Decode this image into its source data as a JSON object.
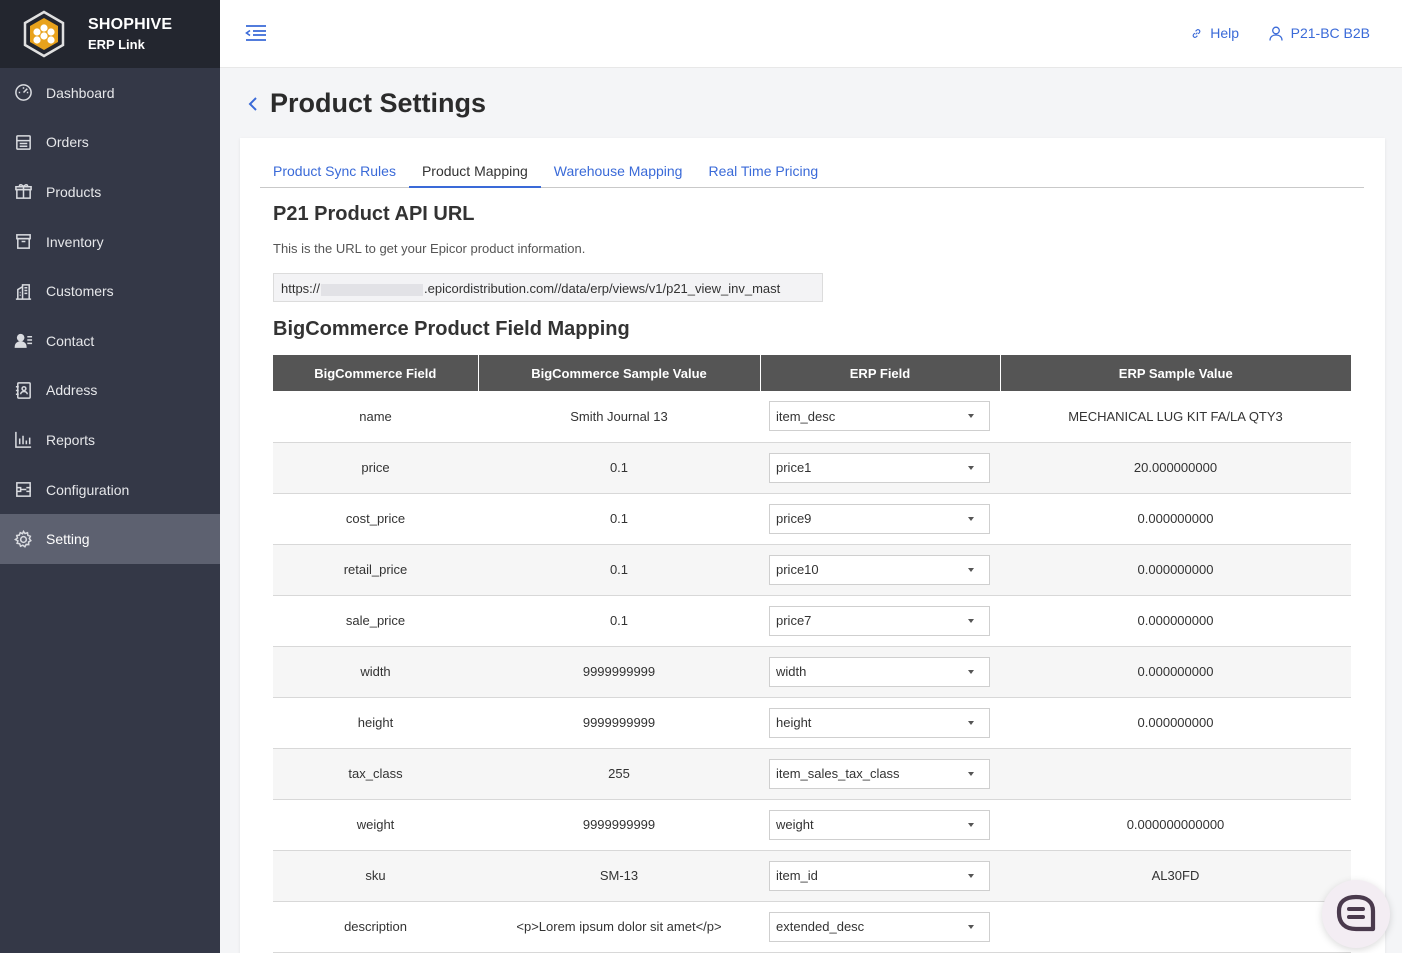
{
  "brand": {
    "name": "SHOPHIVE",
    "sub": "ERP Link"
  },
  "sidebar": {
    "items": [
      {
        "label": "Dashboard",
        "icon": "dashboard-icon"
      },
      {
        "label": "Orders",
        "icon": "orders-icon"
      },
      {
        "label": "Products",
        "icon": "gift-icon"
      },
      {
        "label": "Inventory",
        "icon": "archive-icon"
      },
      {
        "label": "Customers",
        "icon": "building-icon"
      },
      {
        "label": "Contact",
        "icon": "contact-icon"
      },
      {
        "label": "Address",
        "icon": "address-icon"
      },
      {
        "label": "Reports",
        "icon": "bar-chart-icon"
      },
      {
        "label": "Configuration",
        "icon": "configuration-icon"
      },
      {
        "label": "Setting",
        "icon": "gear-icon",
        "active": true
      }
    ]
  },
  "topbar": {
    "help": "Help",
    "user": "P21-BC B2B"
  },
  "page": {
    "title": "Product Settings"
  },
  "tabs": [
    {
      "label": "Product Sync Rules"
    },
    {
      "label": "Product Mapping",
      "active": true
    },
    {
      "label": "Warehouse Mapping"
    },
    {
      "label": "Real Time Pricing"
    }
  ],
  "api_section": {
    "title": "P21 Product API URL",
    "description": "This is the URL to get your Epicor product information.",
    "url_prefix": "https://",
    "url_suffix": ".epicordistribution.com//data/erp/views/v1/p21_view_inv_mast"
  },
  "mapping": {
    "title": "BigCommerce Product Field Mapping",
    "headers": [
      "BigCommerce Field",
      "BigCommerce Sample Value",
      "ERP Field",
      "ERP Sample Value"
    ],
    "rows": [
      {
        "field": "name",
        "sample": "Smith Journal 13",
        "erp_field": "item_desc",
        "erp_sample": "MECHANICAL LUG KIT FA/LA QTY3"
      },
      {
        "field": "price",
        "sample": "0.1",
        "erp_field": "price1",
        "erp_sample": "20.000000000"
      },
      {
        "field": "cost_price",
        "sample": "0.1",
        "erp_field": "price9",
        "erp_sample": "0.000000000"
      },
      {
        "field": "retail_price",
        "sample": "0.1",
        "erp_field": "price10",
        "erp_sample": "0.000000000"
      },
      {
        "field": "sale_price",
        "sample": "0.1",
        "erp_field": "price7",
        "erp_sample": "0.000000000"
      },
      {
        "field": "width",
        "sample": "9999999999",
        "erp_field": "width",
        "erp_sample": "0.000000000"
      },
      {
        "field": "height",
        "sample": "9999999999",
        "erp_field": "height",
        "erp_sample": "0.000000000"
      },
      {
        "field": "tax_class",
        "sample": "255",
        "erp_field": "item_sales_tax_class",
        "erp_sample": ""
      },
      {
        "field": "weight",
        "sample": "9999999999",
        "erp_field": "weight",
        "erp_sample": "0.000000000000"
      },
      {
        "field": "sku",
        "sample": "SM-13",
        "erp_field": "item_id",
        "erp_sample": "AL30FD"
      },
      {
        "field": "description",
        "sample": "<p>Lorem ipsum dolor sit amet</p>",
        "erp_field": "extended_desc",
        "erp_sample": ""
      }
    ]
  },
  "colors": {
    "sidebar": "#343847",
    "brand_bg": "#23262f",
    "active_nav": "#5d6170",
    "link": "#3a6ad8",
    "table_header": "#555555"
  }
}
